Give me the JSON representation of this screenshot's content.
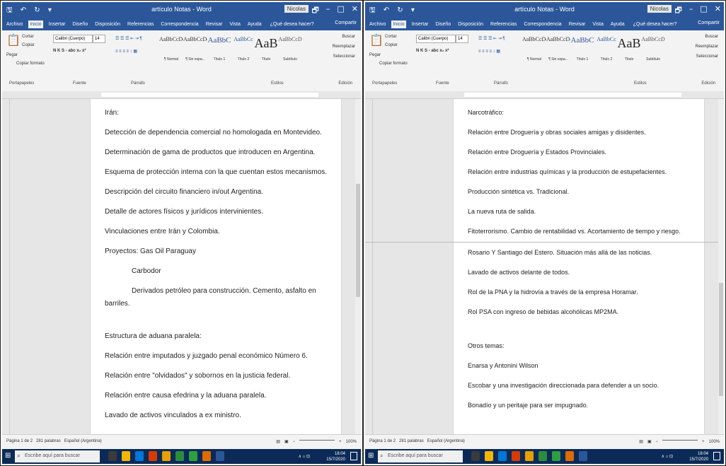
{
  "window": {
    "title": "artículo Notas - Word",
    "user": "Nicolas",
    "qat": "🖫 ↶ ↻ ▾",
    "controls": [
      "🗗",
      "–",
      "□",
      "✕"
    ]
  },
  "tabs": [
    "Archivo",
    "Inicio",
    "Insertar",
    "Diseño",
    "Disposición",
    "Referencias",
    "Correspondencia",
    "Revisar",
    "Vista",
    "Ayuda"
  ],
  "tell_me": "¿Qué desea hacer?",
  "share": "Compartir",
  "ribbon": {
    "clipboard": {
      "paste": "Pegar",
      "cut": "Cortar",
      "copy": "Copiar",
      "format": "Copiar formato",
      "label": "Portapapeles"
    },
    "font": {
      "name": "Calibri (Cuerpo)",
      "size": "14",
      "bold_row": "N K S  -  abc  x₂  x²",
      "label": "Fuente"
    },
    "paragraph": {
      "label": "Párrafo"
    },
    "styles": {
      "label": "Estilos",
      "tiles": [
        {
          "sample": "AaBbCcDd",
          "name": "¶ Normal"
        },
        {
          "sample": "AaBbCcDd",
          "name": "¶ Sin espa..."
        },
        {
          "sample": "AaBbC",
          "name": "Título 1"
        },
        {
          "sample": "AaBbCc",
          "name": "Título 2"
        },
        {
          "sample": "AaB",
          "name": "Título"
        },
        {
          "sample": "AaBbCcD",
          "name": "Subtítulo"
        },
        {
          "sample": "AaBbCcD",
          "name": "Énfasis sutil"
        },
        {
          "sample": "AaBbCcD",
          "name": "Énfasis"
        },
        {
          "sample": "AaBbCcD",
          "name": "Énfasis int..."
        }
      ]
    },
    "editing": {
      "find": "Buscar",
      "replace": "Reemplazar",
      "select": "Seleccionar",
      "label": "Edición"
    }
  },
  "left_doc": {
    "lines": [
      {
        "text": "Irán:"
      },
      {
        "text": "Detección de dependencia comercial no homologada en Montevideo."
      },
      {
        "text": "Determinación de gama de productos que introducen en Argentina."
      },
      {
        "text": "Esquema de protección interna con la que cuentan estos mecanismos."
      },
      {
        "text": "Descripción del circuito financiero in/out Argentina."
      },
      {
        "text": "Detalle de actores físicos y jurídicos intervinientes."
      },
      {
        "text": "Vinculaciones entre Irán y Colombia."
      },
      {
        "text": "Proyectos:  Gas Oil Paraguay"
      },
      {
        "text": "Carbodor"
      },
      {
        "text": "Derivados petróleo para construcción. Cemento, asfalto en"
      },
      {
        "text": "barriles."
      },
      {
        "text": "Estructura de aduana paralela:"
      },
      {
        "text": "Relación entre imputados y juzgado penal económico Número 6."
      },
      {
        "text": "Relación entre \"olvidados\" y sobornos en la justicia federal."
      },
      {
        "text": "Relación entre causa efedrina y la aduana paralela."
      },
      {
        "text": "Lavado de activos vinculados a ex ministro."
      }
    ]
  },
  "right_doc": {
    "lines": [
      {
        "text": "Narcotráfico:"
      },
      {
        "text": "Relación entre Droguería y obras sociales amigas y disidentes."
      },
      {
        "text": "Relación entre Droguería y Estados Provinciales."
      },
      {
        "text": "Relación entre industrias químicas y la producción de estupefacientes."
      },
      {
        "text": "Producción sintética vs. Tradicional."
      },
      {
        "text": "La nueva ruta de salida."
      },
      {
        "text": "Fitoterrorismo. Cambio de rentabilidad vs. Acortamiento de tiempo y riesgo."
      },
      {
        "text": "Rosario Y Santiago del Estero. Situación más allá de las noticias."
      },
      {
        "text": "Lavado de activos delante de todos."
      },
      {
        "text": "Rol de la PNA y la hidrovía a través de la empresa Horamar."
      },
      {
        "text": "Rol PSA con ingreso de bebidas alcohólicas MP2MA."
      },
      {
        "text": "Otros temas:"
      },
      {
        "text": "Enarsa y Antonini Wilson"
      },
      {
        "text": "Escobar y una investigación direccionada para defender a un socio."
      },
      {
        "text": "Bonadío y un peritaje para ser impugnado."
      }
    ]
  },
  "status": {
    "left": {
      "page": "Página 1 de 2",
      "words": "281 palabras",
      "lang": "Español (Argentina)",
      "zoom": "100%"
    },
    "right": {
      "page": "Página 1 de 2",
      "words": "281 palabras",
      "lang": "Español (Argentina)",
      "zoom": "100%"
    }
  },
  "taskbar": {
    "search": "Escribe aquí para buscar",
    "time": "18:04",
    "date": "15/7/2020",
    "tray": "∧ ⌂ ⊡",
    "icon_colors": [
      "#3a3a3a",
      "#f2b705",
      "#0078d7",
      "#d83b01",
      "#e8a000",
      "#2d8c3c",
      "#2e9f3f",
      "#e06c00",
      "#2b579a"
    ]
  }
}
